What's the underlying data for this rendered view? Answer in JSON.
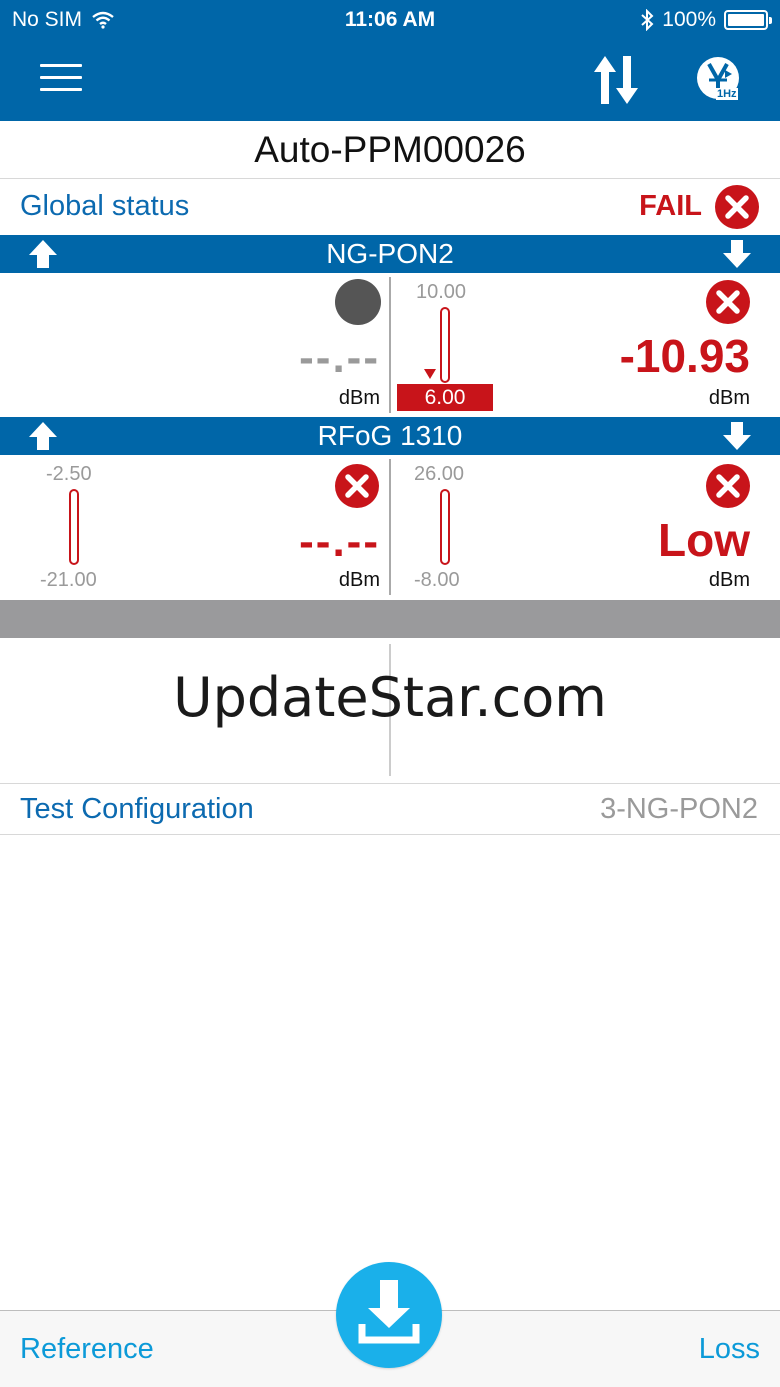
{
  "status_bar": {
    "carrier": "No SIM",
    "time": "11:06 AM",
    "battery": "100%"
  },
  "nav": {
    "modulation_label": "1Hz"
  },
  "title": "Auto-PPM00026",
  "global_status": {
    "label": "Global status",
    "result": "FAIL"
  },
  "bands": [
    {
      "name": "NG-PON2",
      "left": {
        "value": "--.--",
        "unit": "dBm"
      },
      "right": {
        "scale_max": "10.00",
        "threshold": "6.00",
        "value": "-10.93",
        "unit": "dBm"
      }
    },
    {
      "name": "RFoG 1310",
      "left": {
        "scale_max": "-2.50",
        "scale_min": "-21.00",
        "value": "--.--",
        "unit": "dBm"
      },
      "right": {
        "scale_max": "26.00",
        "scale_min": "-8.00",
        "value": "Low",
        "unit": "dBm"
      }
    }
  ],
  "watermark": "UpdateStar.com",
  "test_configuration": {
    "label": "Test Configuration",
    "value": "3-NG-PON2"
  },
  "bottom_bar": {
    "left": "Reference",
    "right": "Loss"
  },
  "colors": {
    "header": "#0066a8",
    "fail": "#c8141a",
    "link": "#0c6ab0",
    "fab": "#1ab0ea"
  }
}
